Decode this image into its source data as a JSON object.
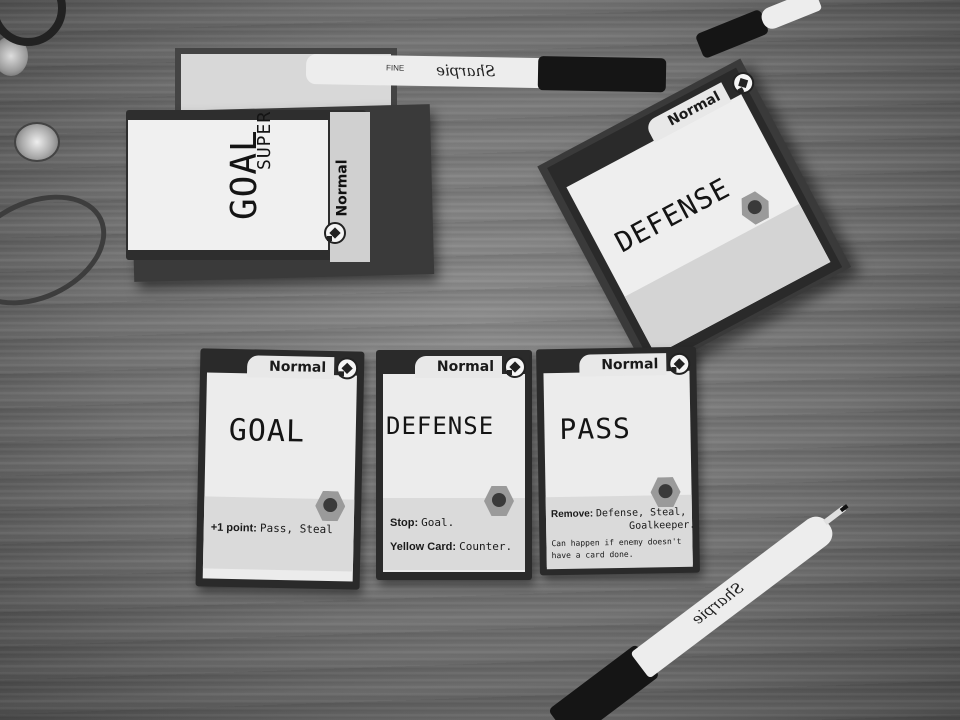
{
  "scene": {
    "description_label": ""
  },
  "cards": {
    "normal_label": "Normal",
    "top_left": {
      "title_line1": "SUPER",
      "title_line2": "GOAL"
    },
    "top_right": {
      "title": "DEFENSE"
    },
    "goal": {
      "title": "GOAL",
      "rule1_key": "+1 point:",
      "rule1_value": "Pass, Steal"
    },
    "defense": {
      "title": "DEFENSE",
      "rule1_key": "Stop:",
      "rule1_value": "Goal.",
      "rule2_key": "Yellow Card:",
      "rule2_value": "Counter."
    },
    "pass": {
      "title": "PASS",
      "rule1_key": "Remove:",
      "rule1_value": "Defense, Steal,",
      "rule1_value_line2": "Goalkeeper.",
      "note_line1": "Can happen if enemy doesn't",
      "note_line2": "have a card done."
    }
  },
  "markers": {
    "top_marker_logo": "Sharpie",
    "top_marker_tag": "FINE",
    "bottom_marker_logo": "Sharpie"
  },
  "colors": {
    "wood_light": "#8a8a8a",
    "wood_dark": "#4a4a4a",
    "card_border": "#2a2a2a",
    "card_face": "#ececec"
  }
}
